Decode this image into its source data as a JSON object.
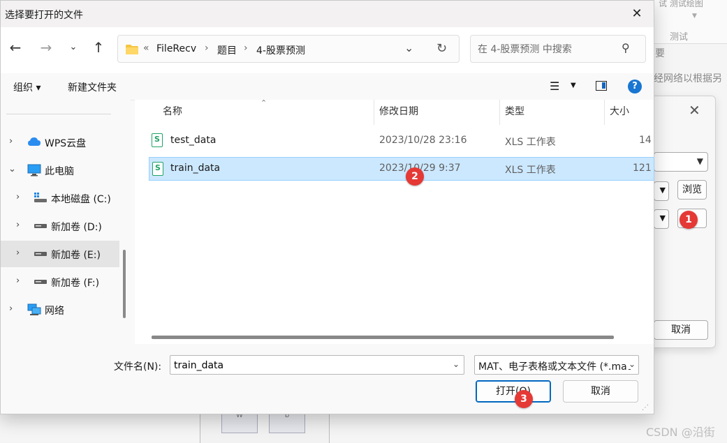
{
  "background": {
    "ribbon_label_top": "试  测试绘图",
    "ribbon_label": "测试",
    "text_line1": "要",
    "text_line2": "经网络以根据另",
    "browse_button": "浏览",
    "cancel_button": "取消",
    "block_left": "W",
    "block_right": "b",
    "watermark": "CSDN @沿街"
  },
  "dialog": {
    "title": "选择要打开的文件",
    "close_glyph": "✕"
  },
  "nav": {
    "back": "←",
    "forward": "→",
    "recent": "⌄",
    "up": "↑"
  },
  "address": {
    "overflow": "«",
    "crumbs": [
      "FileRecv",
      "题目",
      "4-股票预测"
    ],
    "separator": "›"
  },
  "search": {
    "placeholder": "在 4-股票预测 中搜索"
  },
  "toolbar": {
    "organize": "组织 ▾",
    "new_folder": "新建文件夹",
    "help": "?"
  },
  "navpane": {
    "items": [
      {
        "label": "WPS云盘",
        "icon": "cloud-icon",
        "expanded": false
      },
      {
        "label": "此电脑",
        "icon": "computer-icon",
        "expanded": true
      },
      {
        "label": "本地磁盘 (C:)",
        "icon": "drive-c-icon",
        "expanded": false
      },
      {
        "label": "新加卷 (D:)",
        "icon": "drive-icon",
        "expanded": false
      },
      {
        "label": "新加卷 (E:)",
        "icon": "drive-icon",
        "expanded": false,
        "selected": true
      },
      {
        "label": "新加卷 (F:)",
        "icon": "drive-icon",
        "expanded": false
      },
      {
        "label": "网络",
        "icon": "network-icon",
        "expanded": false
      }
    ]
  },
  "filelist": {
    "columns": [
      "名称",
      "修改日期",
      "类型",
      "大小"
    ],
    "rows": [
      {
        "name": "test_data",
        "date": "2023/10/28 23:16",
        "type": "XLS 工作表",
        "size": "14",
        "selected": false
      },
      {
        "name": "train_data",
        "date": "2023/10/29 9:37",
        "type": "XLS 工作表",
        "size": "121",
        "selected": true
      }
    ]
  },
  "bottom": {
    "filename_label": "文件名(N):",
    "filename_value": "train_data",
    "filetype_value": "MAT、电子表格或文本文件 (*.mat",
    "open_button": "打开(O)",
    "cancel_button": "取消"
  },
  "markers": [
    "1",
    "2",
    "3"
  ],
  "colors": {
    "accent": "#0067c0",
    "selection": "#cce8ff",
    "marker": "#e53935",
    "excel_green": "#21a366"
  }
}
